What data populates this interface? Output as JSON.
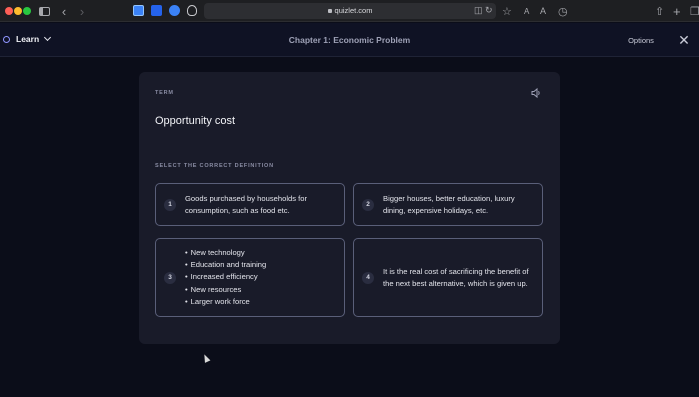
{
  "browser": {
    "url": "quizlet.com",
    "icons": [
      "sidebar-icon",
      "back-icon",
      "forward-icon",
      "translate-icon",
      "reload-icon",
      "star-icon",
      "text-smaller-icon",
      "text-larger-icon",
      "history-icon",
      "share-icon",
      "new-tab-icon",
      "tab-overview-icon"
    ]
  },
  "header": {
    "mode_label": "Learn",
    "deck_title": "Chapter 1: Economic Problem",
    "options_label": "Options",
    "close_icon": "close-icon"
  },
  "card": {
    "term_label": "TERM",
    "term": "Opportunity cost",
    "select_label": "SELECT THE CORRECT DEFINITION",
    "options": [
      {
        "number": "1",
        "text": "Goods purchased by households for consumption, such as food etc."
      },
      {
        "number": "2",
        "text": "Bigger houses, better education, luxury dining, expensive holidays, etc."
      },
      {
        "number": "3",
        "bullets": [
          "New technology",
          "Education and training",
          "Increased efficiency",
          "New resources",
          "Larger work force"
        ]
      },
      {
        "number": "4",
        "text": "It is the real cost of sacrificing the benefit of the next best alternative, which is given up."
      }
    ]
  },
  "colors": {
    "background": "#0b0d19",
    "card": "#191b29",
    "option_border": "#5a5f79",
    "accent": "#8f95ff"
  }
}
